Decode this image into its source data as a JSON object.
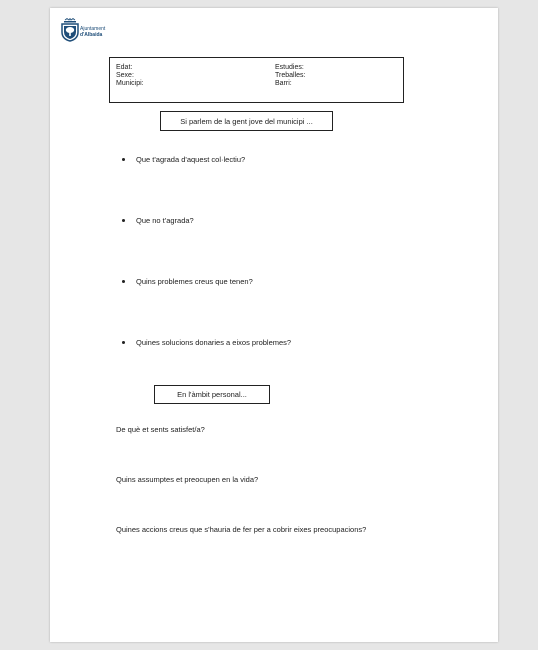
{
  "logo": {
    "line1": "Ajuntament",
    "line2": "d'Albaida"
  },
  "info": {
    "left": [
      "Edat:",
      "Sexe:",
      "Municipi:"
    ],
    "right": [
      "Estudies:",
      "Treballes:",
      "Barri:"
    ]
  },
  "sections": {
    "youth": "Si parlem de la gent jove del municipi ...",
    "personal": "En l'àmbit personal..."
  },
  "youth_questions": [
    "Que t'agrada d'aquest col·lectiu?",
    "Que no t'agrada?",
    "Quins problemes creus que tenen?",
    "Quines solucions donaries a eixos problemes?"
  ],
  "personal_questions": [
    "De què et sents satisfet/a?",
    "Quins assumptes et preocupen en la vida?",
    "Quines accions creus que s'hauria de fer per a cobrir eixes preocupacions?"
  ],
  "colors": {
    "viewer_background": "#e6e6e6",
    "page": "#ffffff",
    "logo_text": "#1f4e79",
    "text": "#222222"
  }
}
